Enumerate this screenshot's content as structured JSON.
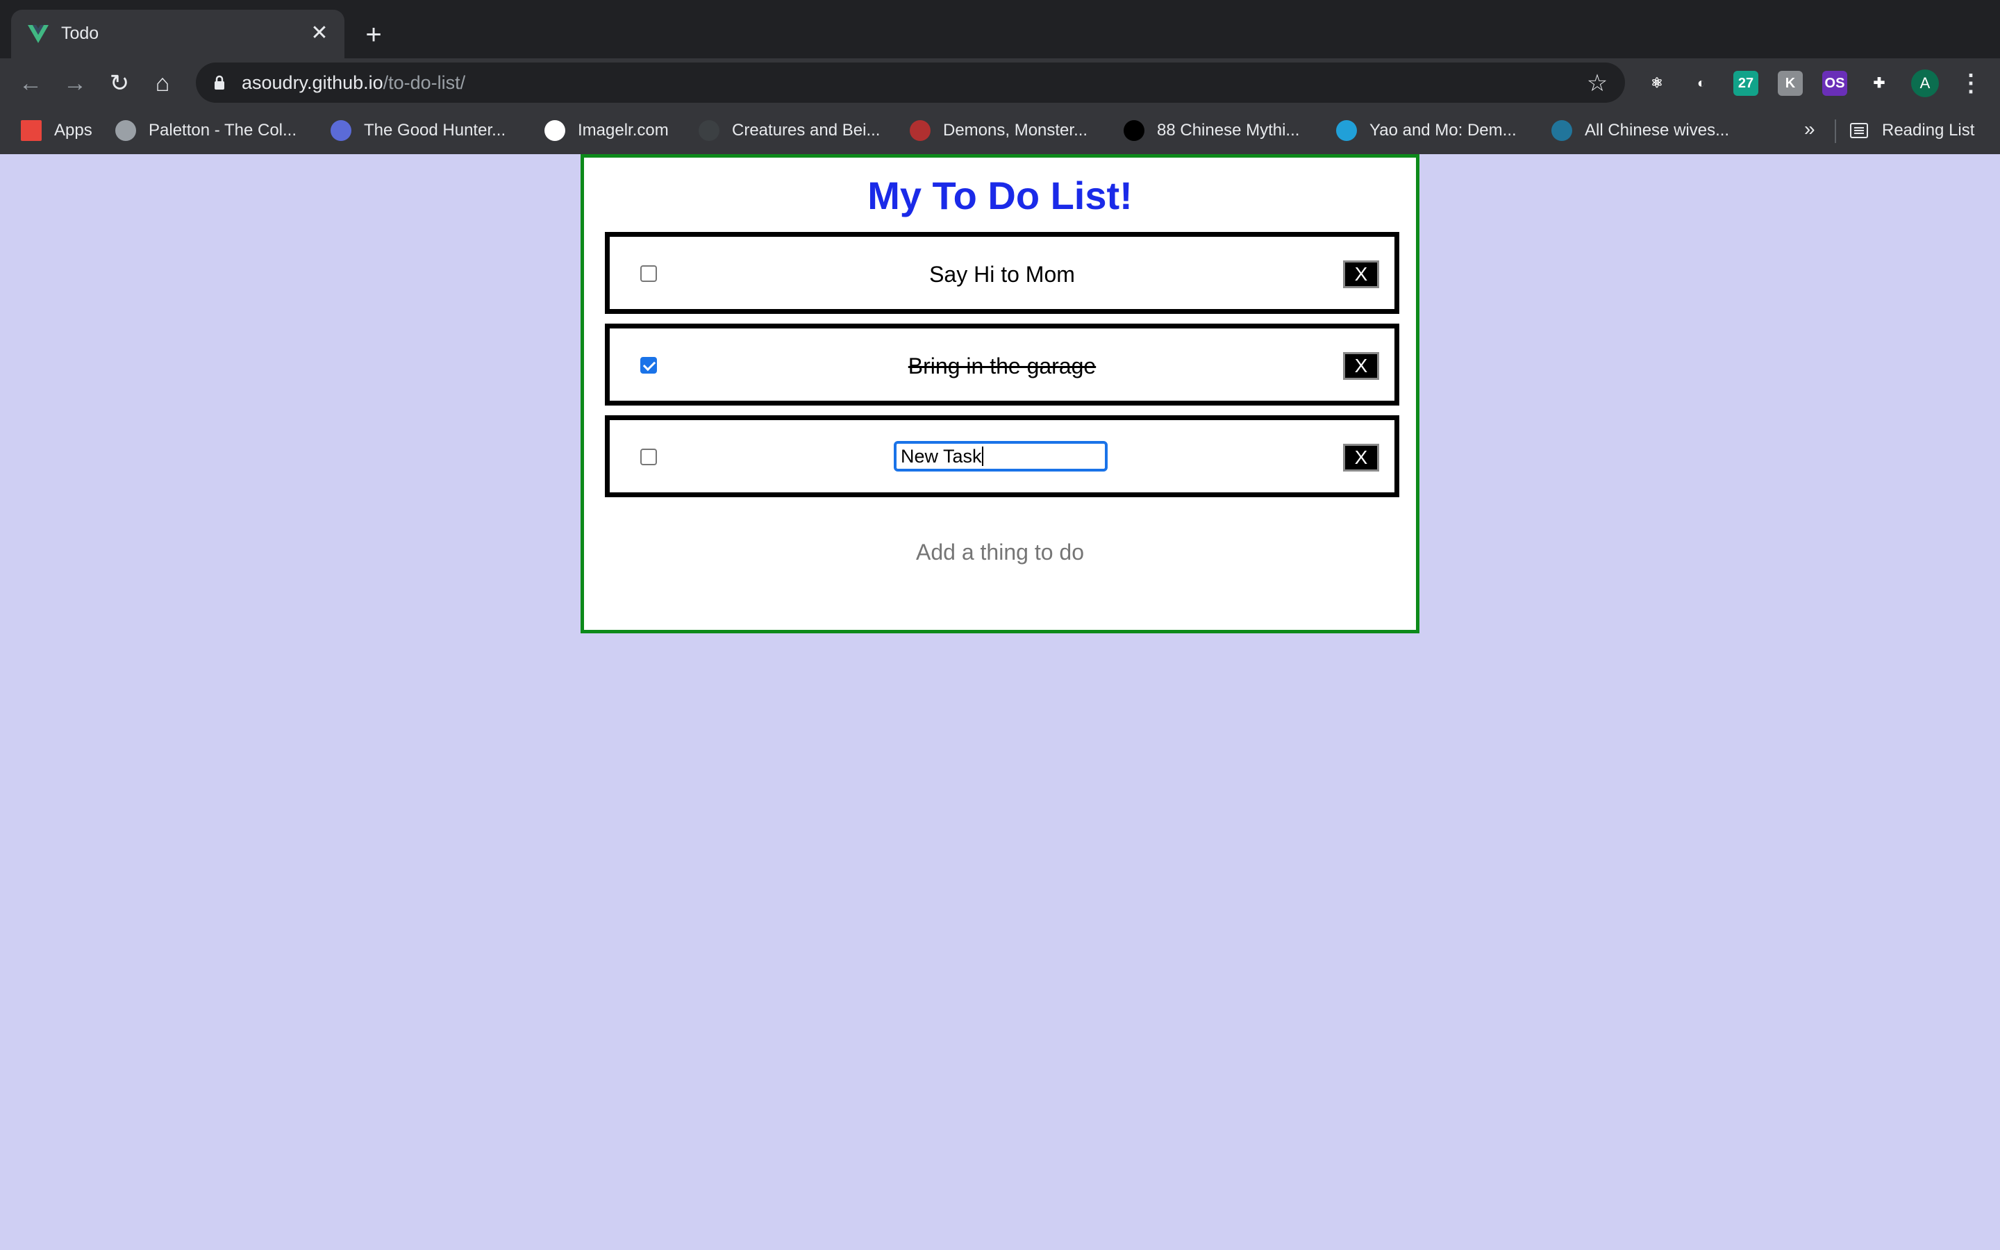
{
  "browser": {
    "tab_title": "Todo",
    "tab_close": "✕",
    "new_tab": "+",
    "url_host": "asoudry.github.io",
    "url_path": "/to-do-list/",
    "back_icon": "←",
    "forward_icon": "→",
    "reload_icon": "↻",
    "home_icon": "⌂",
    "star_icon": "☆",
    "menu_icon": "⋮",
    "avatar_letter": "A",
    "extensions": [
      {
        "name": "react-devtools-icon",
        "glyph": "⚛",
        "color": "#35363a"
      },
      {
        "name": "extension-swirl-icon",
        "glyph": "◐",
        "color": "#35363a"
      },
      {
        "name": "calendar-27-icon",
        "glyph": "27",
        "color": "#12a38a"
      },
      {
        "name": "extension-k-icon",
        "glyph": "K",
        "color": "#8a8d91"
      },
      {
        "name": "extension-os-icon",
        "glyph": "OS",
        "color": "#6a2fb8"
      },
      {
        "name": "puzzle-extensions-icon",
        "glyph": "✚",
        "color": "#35363a"
      }
    ],
    "bookmarks": [
      {
        "label": "Apps",
        "icon": "apps-grid-icon",
        "color": "#e8453c"
      },
      {
        "label": "Paletton - The Col...",
        "icon": "paletton-icon",
        "color": "#9aa0a6"
      },
      {
        "label": "The Good Hunter...",
        "icon": "good-hunter-icon",
        "color": "#5b6bd8"
      },
      {
        "label": "Imagelr.com",
        "icon": "imagelr-icon",
        "color": "#ffffff"
      },
      {
        "label": "Creatures and Bei...",
        "icon": "creatures-icon",
        "color": "#3c4043"
      },
      {
        "label": "Demons, Monster...",
        "icon": "demons-icon",
        "color": "#b03030"
      },
      {
        "label": "88 Chinese Mythi...",
        "icon": "chinese-myth-icon",
        "color": "#000000"
      },
      {
        "label": "Yao and Mo: Dem...",
        "icon": "wordpress-icon",
        "color": "#21a0d8"
      },
      {
        "label": "All Chinese wives...",
        "icon": "wordpress-icon",
        "color": "#21759b"
      }
    ],
    "bookmarks_more": "»",
    "reading_list": "Reading List"
  },
  "todo": {
    "title": "My To Do List!",
    "items": [
      {
        "text": "Say Hi to Mom",
        "done": false
      },
      {
        "text": "Bring in the garage",
        "done": true
      },
      {
        "text": "New Task",
        "done": false,
        "editing": true
      }
    ],
    "delete_label": "X",
    "add_placeholder": "Add a thing to do"
  },
  "colors": {
    "page_background": "#cfcff3",
    "card_border": "#0d8a1a",
    "title_color": "#1a2ae8",
    "checkbox_checked": "#1a73e8"
  }
}
